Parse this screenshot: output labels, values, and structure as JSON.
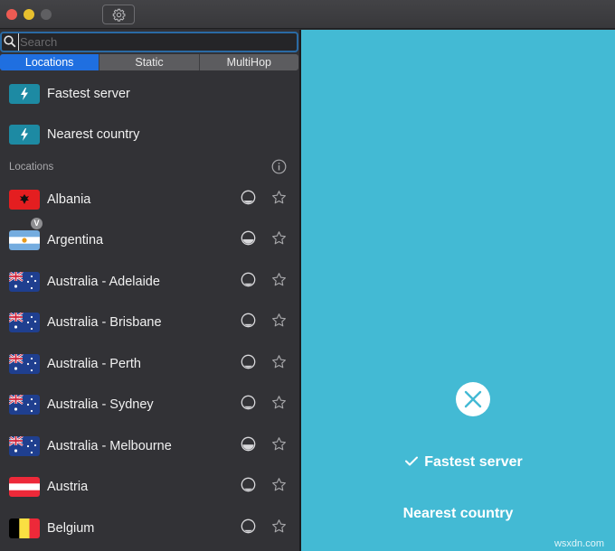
{
  "titlebar": {
    "traffic_lights": [
      "close",
      "minimize",
      "zoom-disabled"
    ],
    "buttons": [
      {
        "name": "sidebar-toggle",
        "icon": "sidebar-icon"
      },
      {
        "name": "settings",
        "icon": "gear-icon"
      }
    ]
  },
  "search": {
    "placeholder": "Search",
    "value": "",
    "icon": "search-icon"
  },
  "tabs": [
    {
      "label": "Locations",
      "active": true
    },
    {
      "label": "Static",
      "active": false
    },
    {
      "label": "MultiHop",
      "active": false
    }
  ],
  "quick_connect": [
    {
      "label": "Fastest server",
      "icon": "bolt-icon"
    },
    {
      "label": "Nearest country",
      "icon": "bolt-icon"
    }
  ],
  "locations_section": {
    "label": "Locations",
    "info_icon": "info-icon"
  },
  "locations": [
    {
      "name": "Albania",
      "flag": "albania",
      "load": 0.25,
      "favorite": false,
      "badge": ""
    },
    {
      "name": "Argentina",
      "flag": "argentina",
      "load": 0.4,
      "favorite": false,
      "badge": "V"
    },
    {
      "name": "Australia - Adelaide",
      "flag": "australia",
      "load": 0.2,
      "favorite": false,
      "badge": ""
    },
    {
      "name": "Australia - Brisbane",
      "flag": "australia",
      "load": 0.2,
      "favorite": false,
      "badge": ""
    },
    {
      "name": "Australia - Perth",
      "flag": "australia",
      "load": 0.2,
      "favorite": false,
      "badge": ""
    },
    {
      "name": "Australia - Sydney",
      "flag": "australia",
      "load": 0.2,
      "favorite": false,
      "badge": ""
    },
    {
      "name": "Australia - Melbourne",
      "flag": "australia",
      "load": 0.45,
      "favorite": false,
      "badge": ""
    },
    {
      "name": "Austria",
      "flag": "austria",
      "load": 0.2,
      "favorite": false,
      "badge": ""
    },
    {
      "name": "Belgium",
      "flag": "belgium",
      "load": 0.2,
      "favorite": false,
      "badge": ""
    }
  ],
  "main": {
    "background": "#43bad4",
    "status_icon": "close-icon",
    "options": [
      {
        "label": "Fastest server",
        "selected": true
      },
      {
        "label": "Nearest country",
        "selected": false
      }
    ],
    "watermark": "wsxdn.com"
  }
}
